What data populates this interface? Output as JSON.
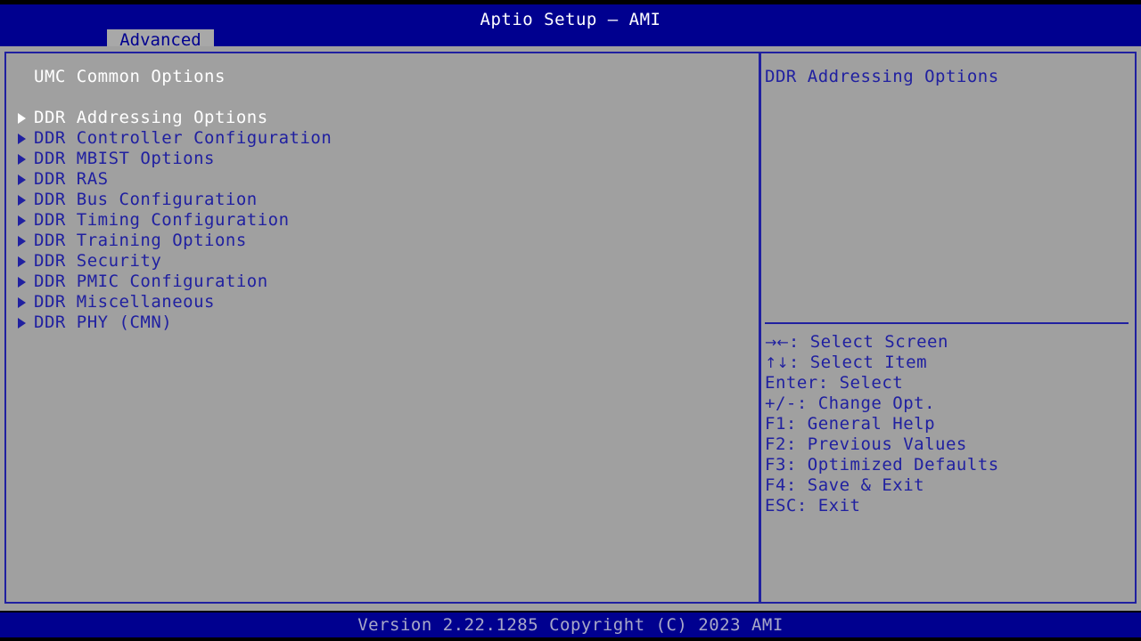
{
  "header": {
    "title": "Aptio Setup – AMI",
    "active_tab": "Advanced",
    "tabs": [
      "Advanced"
    ]
  },
  "colors": {
    "header_bg": "#00008f",
    "body_bg": "#a0a0a0",
    "border": "#2020a0",
    "text_normal": "#2020a0",
    "text_selected": "#ffffff",
    "footer_bg": "#00008f",
    "footer_text": "#a8a8c8",
    "tab_bg": "#a8a8a8"
  },
  "left_pane": {
    "section_title": "UMC Common Options",
    "items": [
      {
        "label": "DDR Addressing Options",
        "icon": "triangle-right-icon",
        "selected": true
      },
      {
        "label": "DDR Controller Configuration",
        "icon": "triangle-right-icon",
        "selected": false
      },
      {
        "label": "DDR MBIST Options",
        "icon": "triangle-right-icon",
        "selected": false
      },
      {
        "label": "DDR RAS",
        "icon": "triangle-right-icon",
        "selected": false
      },
      {
        "label": "DDR Bus Configuration",
        "icon": "triangle-right-icon",
        "selected": false
      },
      {
        "label": "DDR Timing Configuration",
        "icon": "triangle-right-icon",
        "selected": false
      },
      {
        "label": "DDR Training Options",
        "icon": "triangle-right-icon",
        "selected": false
      },
      {
        "label": "DDR Security",
        "icon": "triangle-right-icon",
        "selected": false
      },
      {
        "label": "DDR PMIC Configuration",
        "icon": "triangle-right-icon",
        "selected": false
      },
      {
        "label": "DDR Miscellaneous",
        "icon": "triangle-right-icon",
        "selected": false
      },
      {
        "label": "DDR PHY (CMN)",
        "icon": "triangle-right-icon",
        "selected": false
      }
    ]
  },
  "right_pane": {
    "help_title": "DDR Addressing Options",
    "key_legend": [
      {
        "glyph": "→←",
        "text": ": Select Screen"
      },
      {
        "glyph": "↑↓",
        "text": ": Select Item"
      },
      {
        "glyph": "",
        "text": "Enter: Select"
      },
      {
        "glyph": "",
        "text": "+/-: Change Opt."
      },
      {
        "glyph": "",
        "text": "F1: General Help"
      },
      {
        "glyph": "",
        "text": "F2: Previous Values"
      },
      {
        "glyph": "",
        "text": "F3: Optimized Defaults"
      },
      {
        "glyph": "",
        "text": "F4: Save & Exit"
      },
      {
        "glyph": "",
        "text": "ESC: Exit"
      }
    ]
  },
  "footer": {
    "version_text": "Version 2.22.1285 Copyright (C) 2023 AMI"
  }
}
